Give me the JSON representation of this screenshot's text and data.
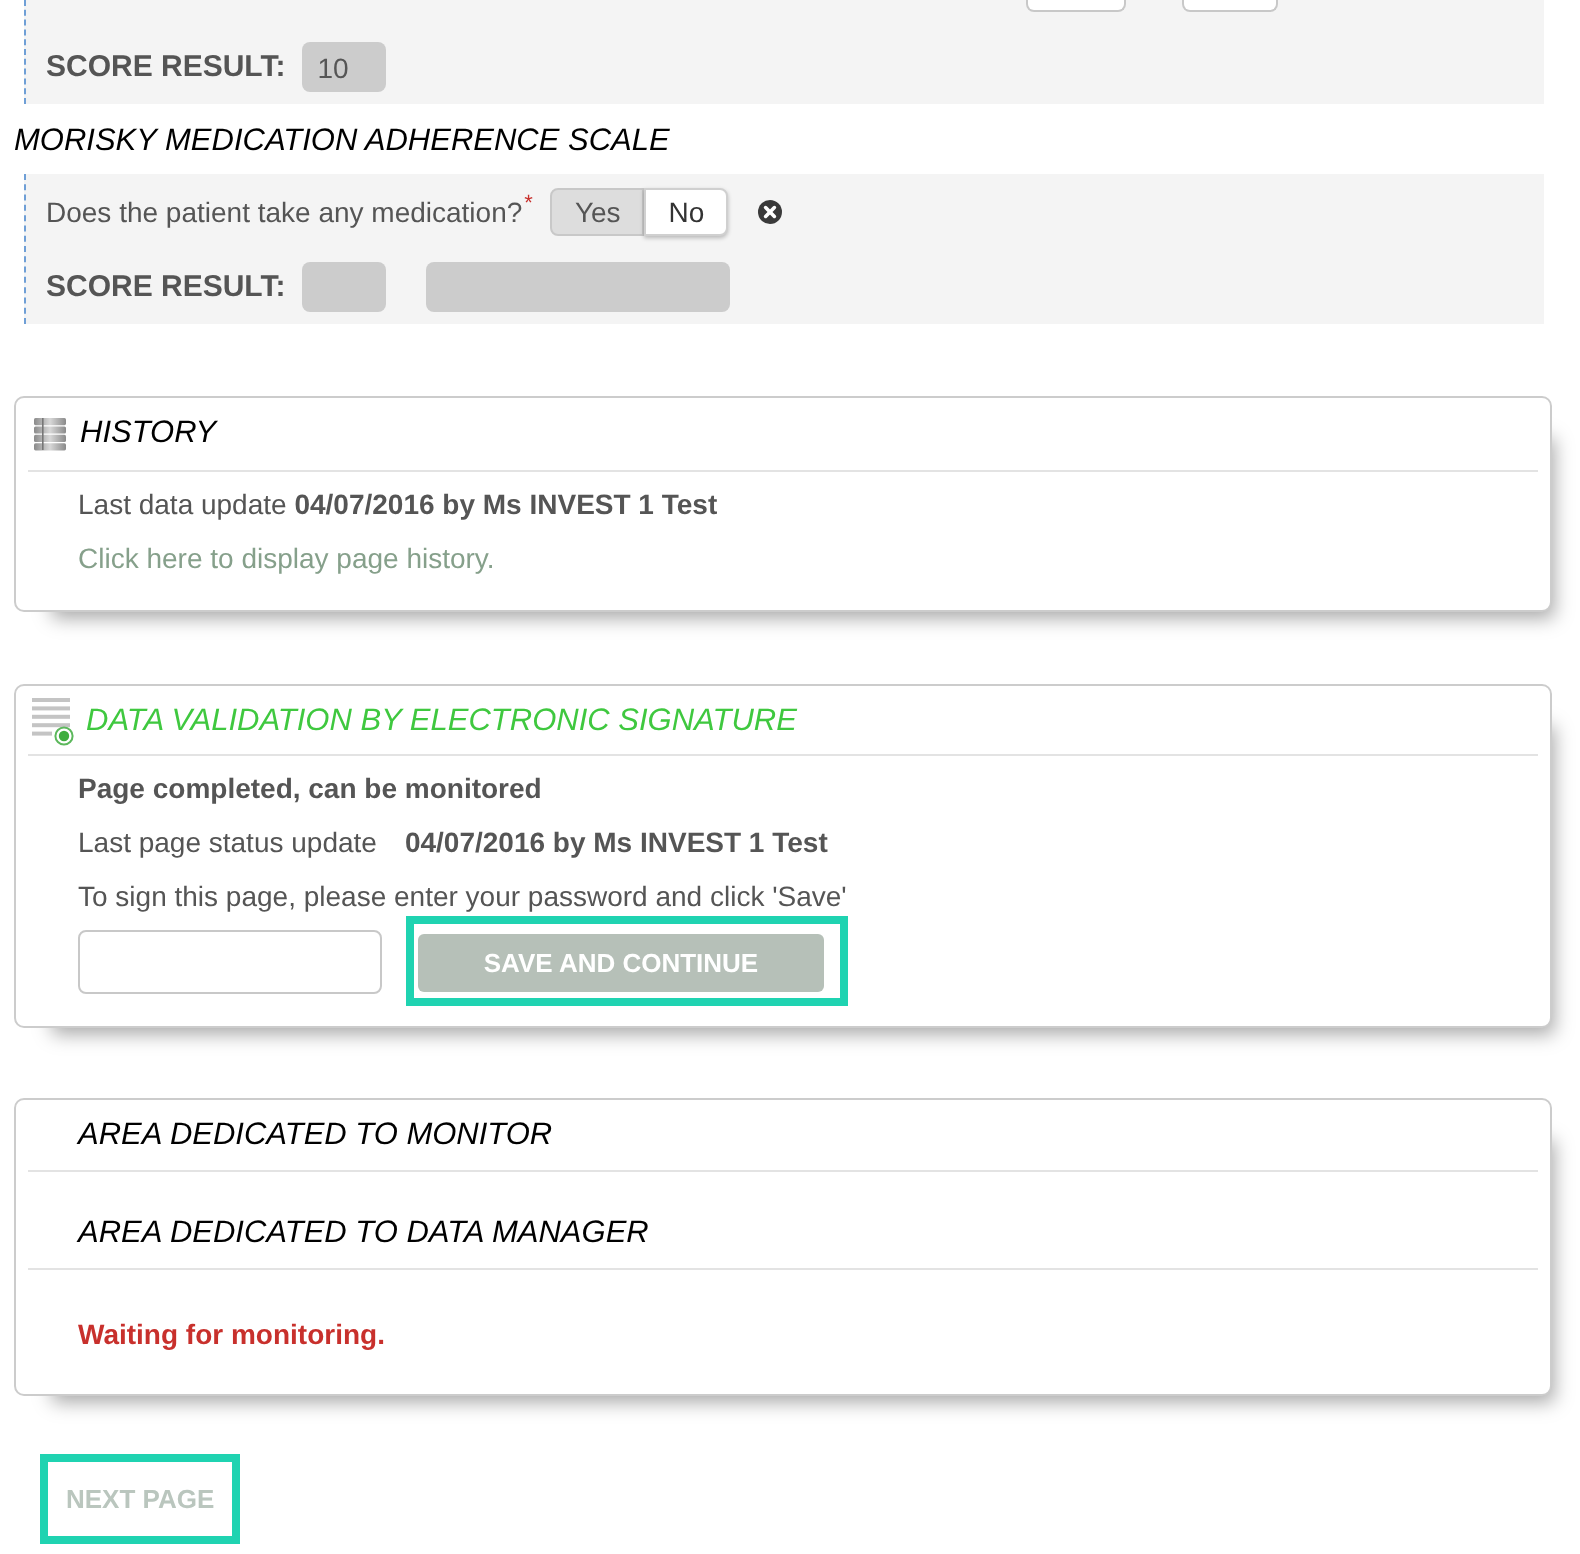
{
  "assessment": {
    "score_label": "SCORE RESULT:",
    "score_value": "10"
  },
  "morisky": {
    "title": "MORISKY MEDICATION ADHERENCE SCALE",
    "question": {
      "label": "Does the patient take any medication?",
      "required_mark": "*",
      "options": [
        {
          "label": "Yes",
          "selected": false
        },
        {
          "label": "No",
          "selected": true
        }
      ]
    },
    "score_label": "SCORE RESULT:"
  },
  "history": {
    "title": "HISTORY",
    "last_update": "Last data update **04/07/2016 by Ms INVEST 1 Test**",
    "link": "Click here to display page history."
  },
  "validation": {
    "title": "DATA VALIDATION BY ELECTRONIC SIGNATURE",
    "status": "Page completed, can be monitored",
    "status_update": {
      "label": "Last page status update",
      "value": "04/07/2016 by Ms INVEST 1 Test"
    },
    "instruction": "To sign this page, please enter your password and click 'Save'",
    "save_button": {
      "label": "SAVE AND CONTINUE",
      "disabled": true,
      "highlighted": true
    }
  },
  "review": {
    "areas": [
      {
        "title": "AREA DEDICATED TO MONITOR"
      },
      {
        "title": "AREA DEDICATED TO DATA MANAGER"
      }
    ],
    "status": "Waiting for monitoring."
  },
  "next_button": {
    "label": "NEXT PAGE",
    "disabled": true,
    "highlighted": true
  }
}
